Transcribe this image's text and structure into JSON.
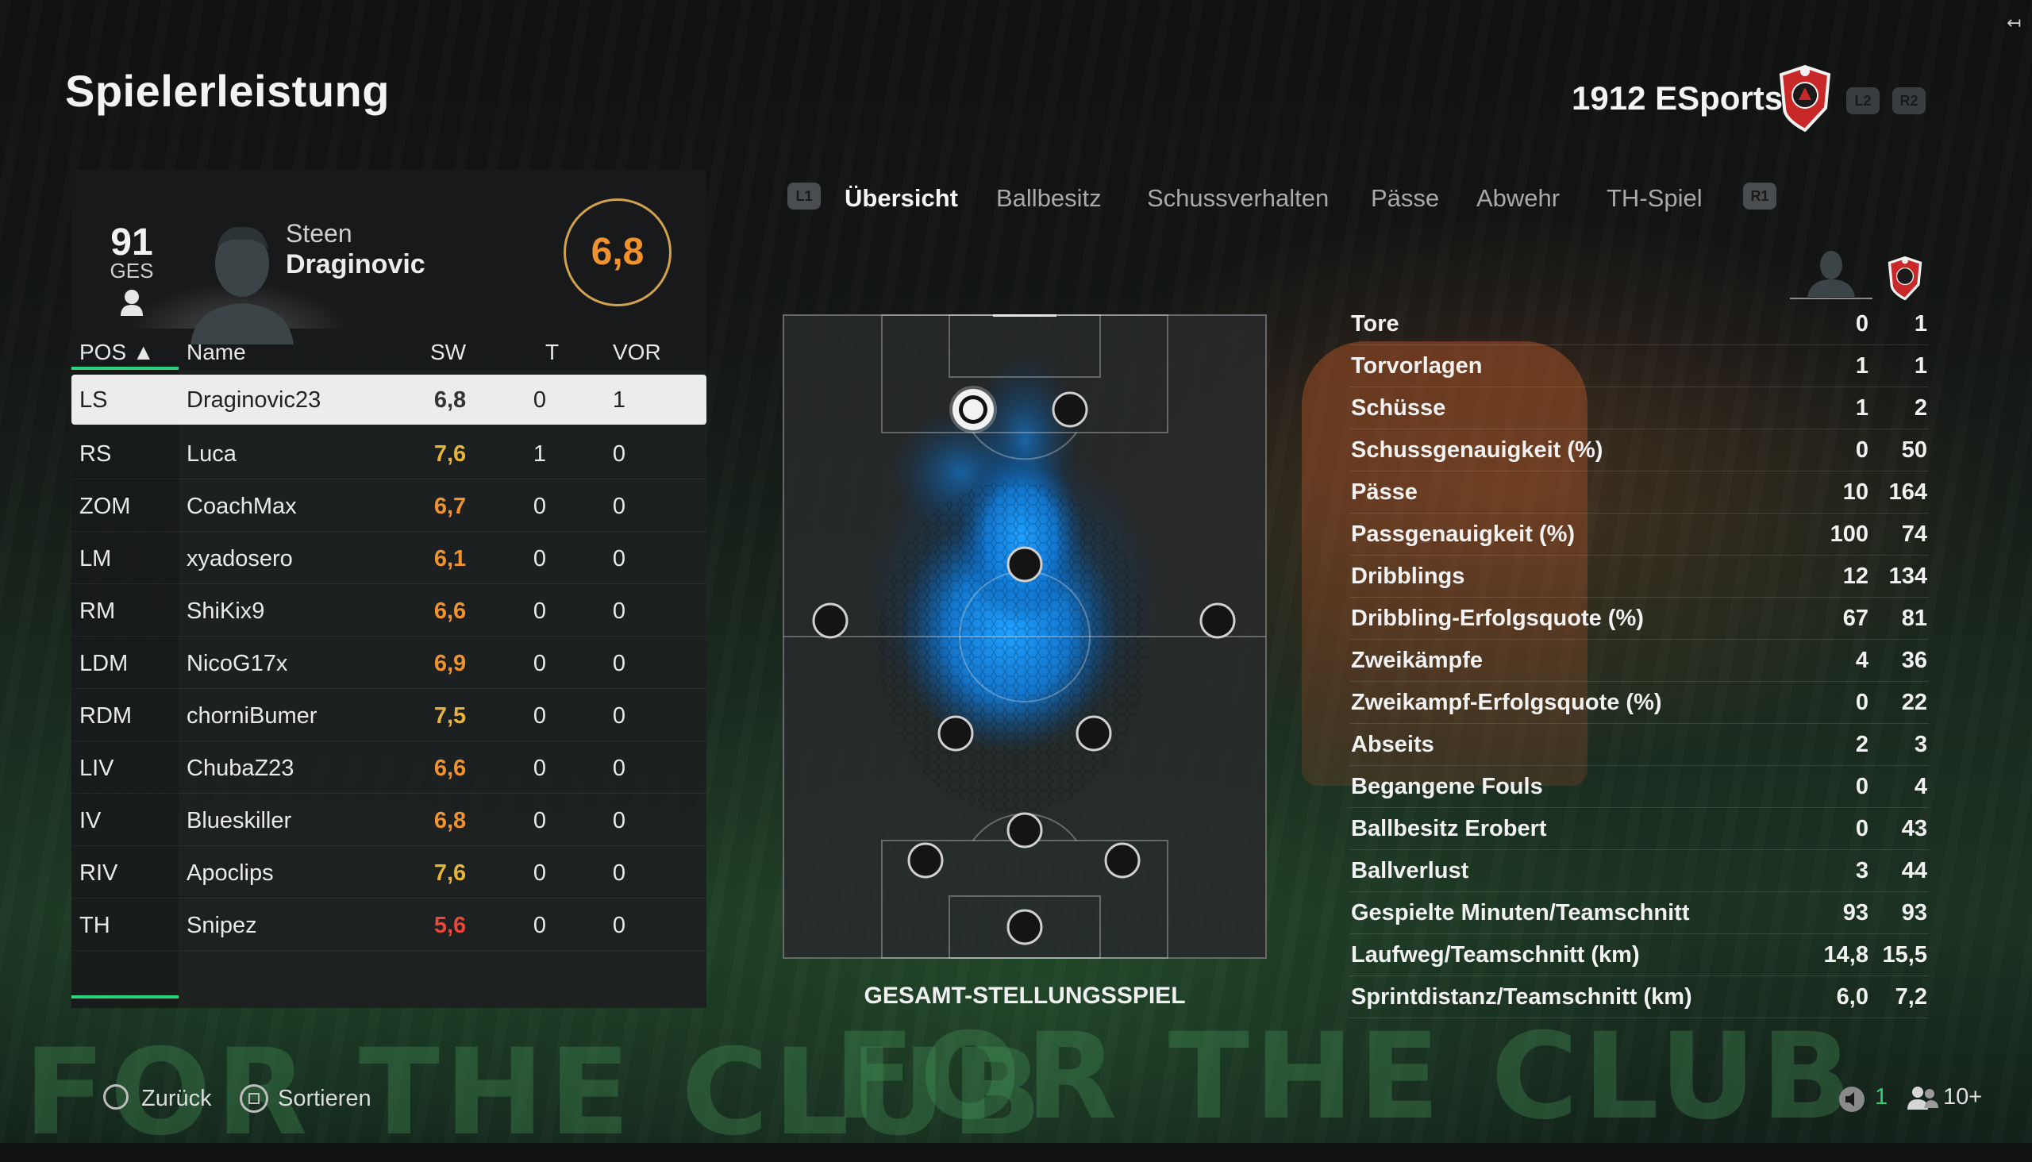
{
  "header": {
    "title": "Spielerleistung",
    "club_name": "1912 ESports",
    "l2": "L2",
    "r2": "R2",
    "corner_glyph": "↤"
  },
  "player": {
    "overall": "91",
    "overall_label": "GES",
    "first_name": "Steen",
    "last_name": "Draginovic",
    "rating": "6,8"
  },
  "table": {
    "headers": {
      "pos": "POS ▲",
      "name": "Name",
      "sw": "SW",
      "t": "T",
      "vor": "VOR"
    },
    "rows": [
      {
        "pos": "LS",
        "name": "Draginovic23",
        "sw": "6,8",
        "t": "0",
        "vor": "1",
        "sw_color": "#333333"
      },
      {
        "pos": "RS",
        "name": "Luca",
        "sw": "7,6",
        "t": "1",
        "vor": "0",
        "sw_color": "#e6b43a"
      },
      {
        "pos": "ZOM",
        "name": "CoachMax",
        "sw": "6,7",
        "t": "0",
        "vor": "0",
        "sw_color": "#f0922e"
      },
      {
        "pos": "LM",
        "name": "xyadosero",
        "sw": "6,1",
        "t": "0",
        "vor": "0",
        "sw_color": "#f0922e"
      },
      {
        "pos": "RM",
        "name": "ShiKix9",
        "sw": "6,6",
        "t": "0",
        "vor": "0",
        "sw_color": "#f0922e"
      },
      {
        "pos": "LDM",
        "name": "NicoG17x",
        "sw": "6,9",
        "t": "0",
        "vor": "0",
        "sw_color": "#f0922e"
      },
      {
        "pos": "RDM",
        "name": "chorniBumer",
        "sw": "7,5",
        "t": "0",
        "vor": "0",
        "sw_color": "#e6b43a"
      },
      {
        "pos": "LIV",
        "name": "ChubaZ23",
        "sw": "6,6",
        "t": "0",
        "vor": "0",
        "sw_color": "#f0922e"
      },
      {
        "pos": "IV",
        "name": "Blueskiller",
        "sw": "6,8",
        "t": "0",
        "vor": "0",
        "sw_color": "#f0922e"
      },
      {
        "pos": "RIV",
        "name": "Apoclips",
        "sw": "7,6",
        "t": "0",
        "vor": "0",
        "sw_color": "#e6b43a"
      },
      {
        "pos": "TH",
        "name": "Snipez",
        "sw": "5,6",
        "t": "0",
        "vor": "0",
        "sw_color": "#e8473a"
      }
    ]
  },
  "tabs": {
    "l1": "L1",
    "r1": "R1",
    "items": [
      "Übersicht",
      "Ballbesitz",
      "Schussverhalten",
      "Pässe",
      "Abwehr",
      "TH-Spiel"
    ],
    "active": "Übersicht"
  },
  "pitch": {
    "caption": "GESAMT-STELLUNGSSPIEL"
  },
  "stats": [
    {
      "label": "Tore",
      "player": "0",
      "team": "1"
    },
    {
      "label": "Torvorlagen",
      "player": "1",
      "team": "1"
    },
    {
      "label": "Schüsse",
      "player": "1",
      "team": "2"
    },
    {
      "label": "Schussgenauigkeit (%)",
      "player": "0",
      "team": "50"
    },
    {
      "label": "Pässe",
      "player": "10",
      "team": "164"
    },
    {
      "label": "Passgenauigkeit (%)",
      "player": "100",
      "team": "74"
    },
    {
      "label": "Dribblings",
      "player": "12",
      "team": "134"
    },
    {
      "label": "Dribbling-Erfolgsquote (%)",
      "player": "67",
      "team": "81"
    },
    {
      "label": "Zweikämpfe",
      "player": "4",
      "team": "36"
    },
    {
      "label": "Zweikampf-Erfolgsquote (%)",
      "player": "0",
      "team": "22"
    },
    {
      "label": "Abseits",
      "player": "2",
      "team": "3"
    },
    {
      "label": "Begangene Fouls",
      "player": "0",
      "team": "4"
    },
    {
      "label": "Ballbesitz Erobert",
      "player": "0",
      "team": "43"
    },
    {
      "label": "Ballverlust",
      "player": "3",
      "team": "44"
    },
    {
      "label": "Gespielte Minuten/Teamschnitt",
      "player": "93",
      "team": "93"
    },
    {
      "label": "Laufweg/Teamschnitt (km)",
      "player": "14,8",
      "team": "15,5"
    },
    {
      "label": "Sprintdistanz/Teamschnitt (km)",
      "player": "6,0",
      "team": "7,2"
    }
  ],
  "footer": {
    "back_label": "Zurück",
    "sort_label": "Sortieren",
    "count_green": "1",
    "party_count": "10+"
  },
  "colors": {
    "accent_green": "#2bd27a",
    "rating_orange": "#f0922e",
    "heatmap_blue": "#1a8fe8"
  }
}
